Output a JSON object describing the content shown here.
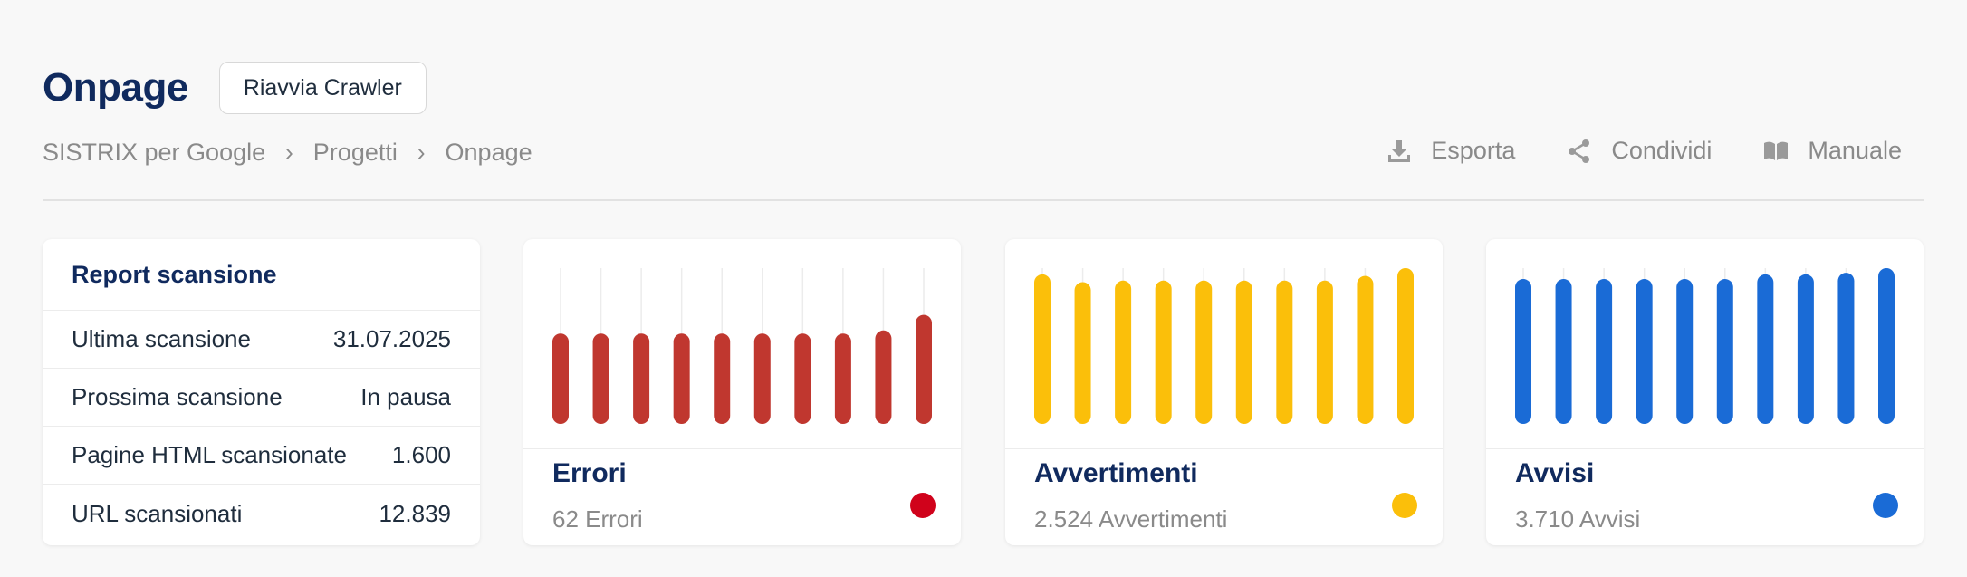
{
  "page": {
    "title": "Onpage",
    "restart_button": "Riavvia Crawler"
  },
  "breadcrumb": [
    "SISTRIX per Google",
    "Progetti",
    "Onpage"
  ],
  "actions": {
    "export": {
      "label": "Esporta",
      "icon": "download-icon"
    },
    "share": {
      "label": "Condividi",
      "icon": "share-icon"
    },
    "manual": {
      "label": "Manuale",
      "icon": "book-icon"
    }
  },
  "report": {
    "title": "Report scansione",
    "rows": [
      {
        "label": "Ultima scansione",
        "value": "31.07.2025"
      },
      {
        "label": "Prossima scansione",
        "value": "In pausa"
      },
      {
        "label": "Pagine HTML scansionate",
        "value": "1.600"
      },
      {
        "label": "URL scansionati",
        "value": "12.839"
      }
    ]
  },
  "cards": [
    {
      "title": "Errori",
      "subtitle": "62 Errori",
      "color": "#c0372f",
      "dot_color": "#d0021b"
    },
    {
      "title": "Avvertimenti",
      "subtitle": "2.524 Avvertimenti",
      "color": "#fbbf0a",
      "dot_color": "#fbbf0a"
    },
    {
      "title": "Avvisi",
      "subtitle": "3.710 Avvisi",
      "color": "#1a6bd6",
      "dot_color": "#1a6bd6"
    }
  ],
  "chart_data": [
    {
      "type": "bar",
      "series": [
        {
          "values": [
            58,
            58,
            58,
            58,
            58,
            58,
            58,
            58,
            60,
            70
          ]
        }
      ],
      "ylim": [
        0,
        100
      ]
    },
    {
      "type": "bar",
      "series": [
        {
          "values": [
            96,
            91,
            92,
            92,
            92,
            92,
            92,
            92,
            95,
            100
          ]
        }
      ],
      "ylim": [
        0,
        100
      ]
    },
    {
      "type": "bar",
      "series": [
        {
          "values": [
            93,
            93,
            93,
            93,
            93,
            93,
            96,
            96,
            97,
            100
          ]
        }
      ],
      "ylim": [
        0,
        100
      ]
    }
  ]
}
